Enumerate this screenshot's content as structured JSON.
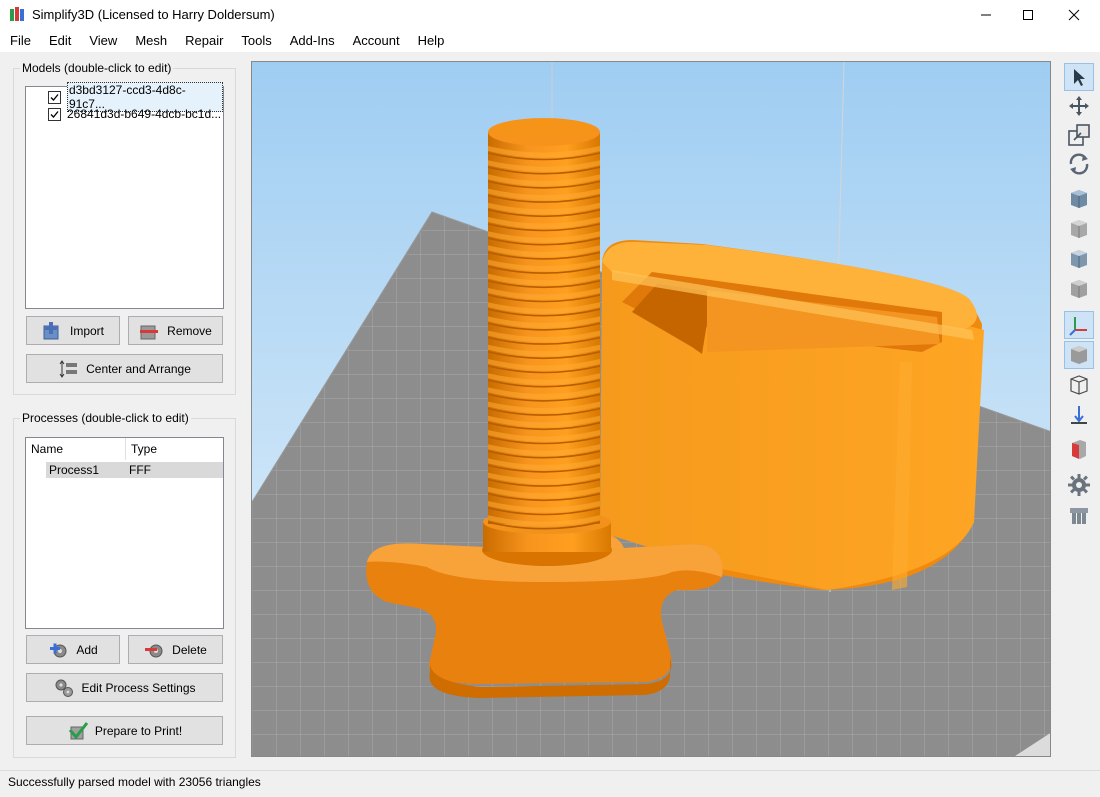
{
  "window": {
    "title": "Simplify3D (Licensed to Harry Doldersum)"
  },
  "menu": [
    "File",
    "Edit",
    "View",
    "Mesh",
    "Repair",
    "Tools",
    "Add-Ins",
    "Account",
    "Help"
  ],
  "models": {
    "group_title": "Models (double-click to edit)",
    "items": [
      {
        "label": "d3bd3127-ccd3-4d8c-91c7...",
        "checked": true,
        "selected": true
      },
      {
        "label": "26841d3d-b649-4dcb-bc1d...",
        "checked": true,
        "selected": false
      }
    ],
    "import_label": "Import",
    "remove_label": "Remove",
    "center_label": "Center and Arrange"
  },
  "processes": {
    "group_title": "Processes (double-click to edit)",
    "columns": [
      "Name",
      "Type"
    ],
    "rows": [
      {
        "name": "Process1",
        "type": "FFF"
      }
    ],
    "add_label": "Add",
    "delete_label": "Delete",
    "edit_label": "Edit Process Settings",
    "prepare_label": "Prepare to Print!"
  },
  "status": {
    "text": "Successfully parsed model with 23056 triangles"
  },
  "toolbar_icons": [
    "select-arrow-icon",
    "move-icon",
    "scale-icon",
    "rotate-icon",
    "view-iso-icon",
    "view-front-icon",
    "view-top-icon",
    "view-side-icon",
    "axes-icon",
    "solid-view-icon",
    "wireframe-icon",
    "bed-icon",
    "cross-section-icon",
    "settings-gear-icon",
    "extruder-icon"
  ],
  "colors": {
    "model_orange": "#f7941d",
    "sky_top": "#a8d4f5",
    "bed_gray": "#8a8a8a",
    "accent_blue": "#4a90d9"
  }
}
